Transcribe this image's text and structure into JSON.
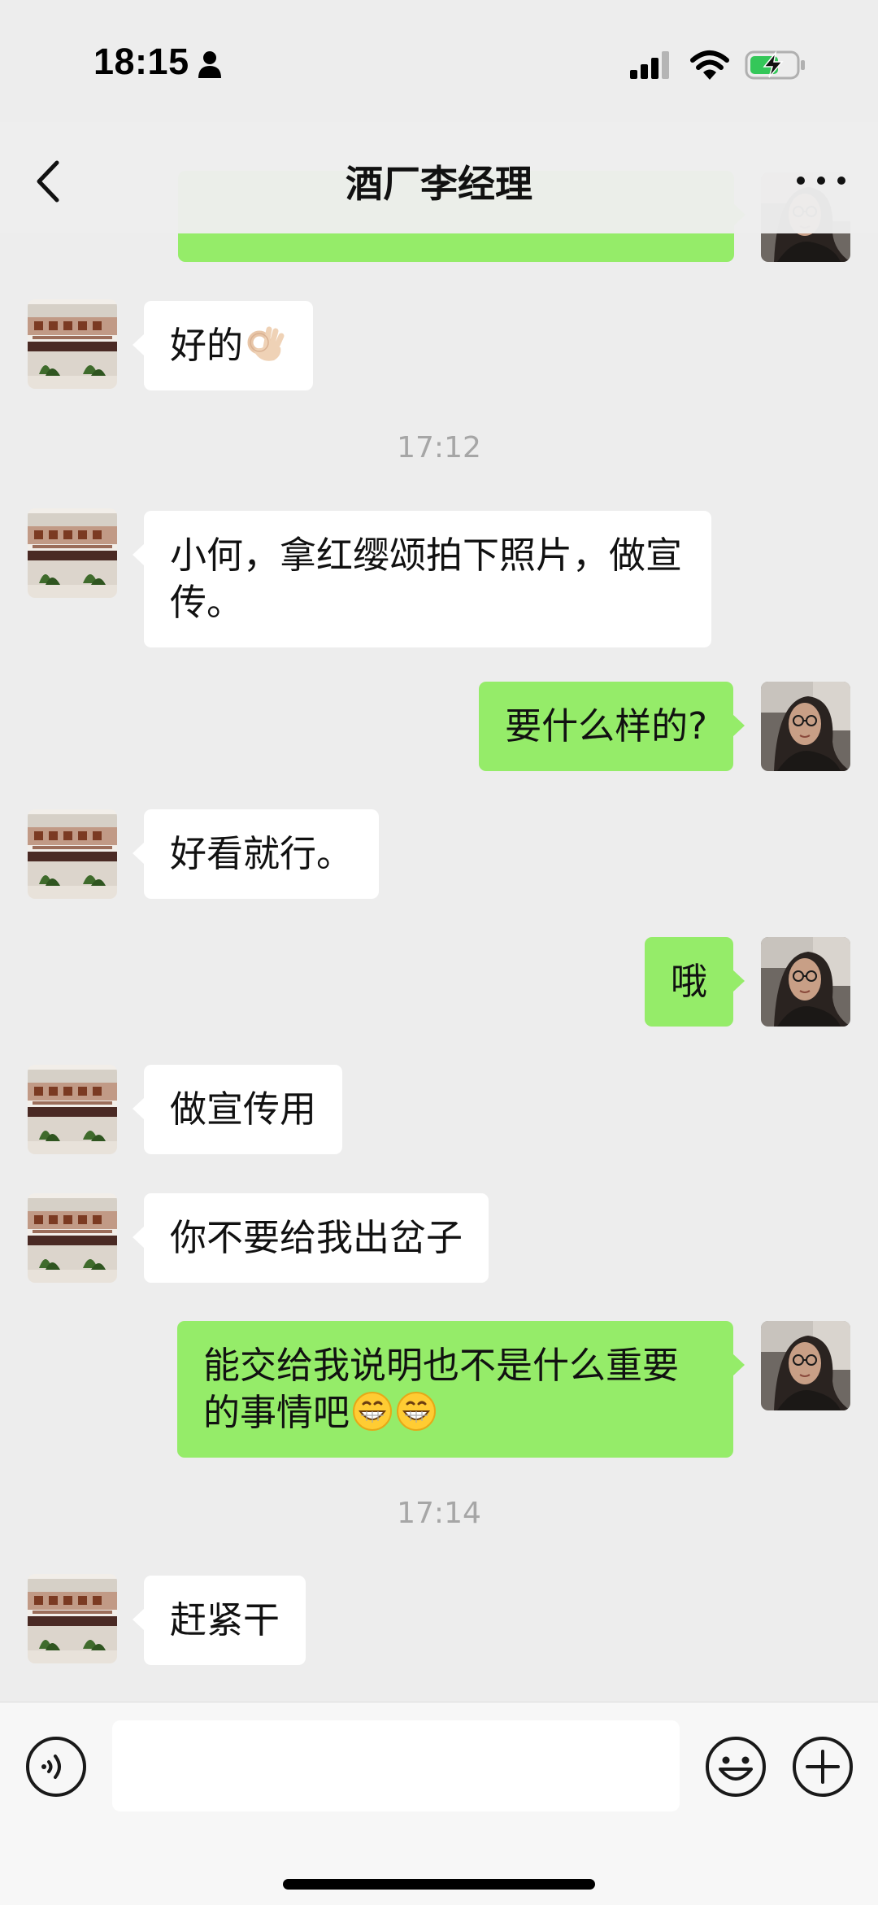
{
  "status_bar": {
    "time": "18:15",
    "person_icon": "person-icon",
    "signal_icon": "signal-icon",
    "wifi_icon": "wifi-icon",
    "battery_icon": "battery-charging-icon"
  },
  "nav": {
    "title": "酒厂李经理",
    "back_icon": "chevron-left-icon",
    "more_icon": "more-dots-icon"
  },
  "messages": [
    {
      "type": "out",
      "text": ""
    },
    {
      "type": "in",
      "text": "好的",
      "emoji": "ok-hand-emoji"
    },
    {
      "type": "time",
      "text": "17:12"
    },
    {
      "type": "in",
      "text": "小何，拿红缨颂拍下照片，做宣传。"
    },
    {
      "type": "out",
      "text": "要什么样的?"
    },
    {
      "type": "in",
      "text": "好看就行。"
    },
    {
      "type": "out",
      "text": "哦"
    },
    {
      "type": "in",
      "text": "做宣传用"
    },
    {
      "type": "in",
      "text": "你不要给我出岔子"
    },
    {
      "type": "out",
      "text": "能交给我说明也不是什么重要的事情吧",
      "emoji": "grinning-emoji ×2"
    },
    {
      "type": "time",
      "text": "17:14"
    },
    {
      "type": "in",
      "text": "赶紧干"
    }
  ],
  "input_bar": {
    "input_value": "",
    "voice_icon": "voice-icon",
    "emoji_icon": "emoji-face-icon",
    "plus_icon": "plus-circle-icon"
  },
  "colors": {
    "background": "#ededed",
    "incoming_bubble": "#ffffff",
    "outgoing_bubble": "#95ec69",
    "timestamp": "#a6a6a6",
    "input_bar": "#f7f7f7"
  }
}
